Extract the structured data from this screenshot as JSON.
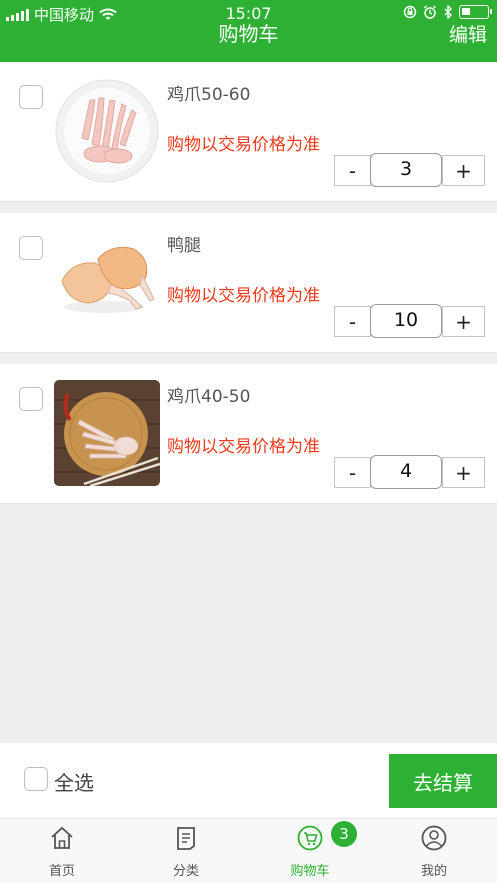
{
  "status_bar": {
    "carrier": "中国移动",
    "time": "15:07"
  },
  "header": {
    "title": "购物车",
    "edit_label": "编辑"
  },
  "cart": {
    "items": [
      {
        "name": "鸡爪50-60",
        "price_note": "购物以交易价格为准",
        "quantity": "3",
        "minus_label": "-",
        "plus_label": "+"
      },
      {
        "name": "鸭腿",
        "price_note": "购物以交易价格为准",
        "quantity": "10",
        "minus_label": "-",
        "plus_label": "+"
      },
      {
        "name": "鸡爪40-50",
        "price_note": "购物以交易价格为准",
        "quantity": "4",
        "minus_label": "-",
        "plus_label": "+"
      }
    ]
  },
  "footer": {
    "select_all_label": "全选",
    "checkout_label": "去结算"
  },
  "tabbar": {
    "tabs": [
      {
        "label": "首页",
        "icon": "home-icon"
      },
      {
        "label": "分类",
        "icon": "category-icon"
      },
      {
        "label": "购物车",
        "icon": "cart-icon",
        "active": true
      },
      {
        "label": "我的",
        "icon": "user-icon"
      }
    ],
    "cart_badge": "3"
  },
  "colors": {
    "brand_green": "#2eb035",
    "price_red": "#ee3a1d"
  }
}
